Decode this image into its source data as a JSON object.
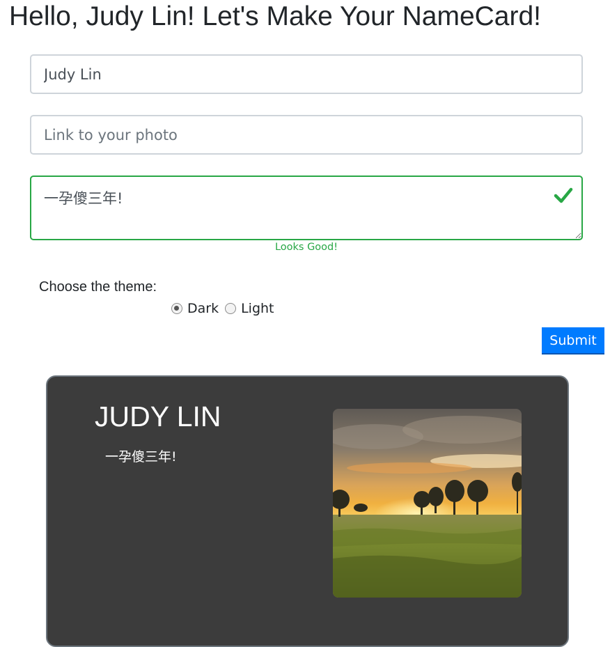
{
  "header": {
    "title": "Hello, Judy Lin! Let's Make Your NameCard!"
  },
  "form": {
    "name_value": "Judy Lin",
    "photo_placeholder": "Link to your photo",
    "photo_value": "",
    "motto_value": "一孕傻三年!",
    "motto_feedback": "Looks Good!",
    "theme_label": "Choose the theme:",
    "theme_options": [
      "Dark",
      "Light"
    ],
    "theme_selected": "Dark",
    "submit_label": "Submit"
  },
  "card": {
    "name": "JUDY LIN",
    "motto": "一孕傻三年!",
    "theme": "Dark",
    "photo_icon": "landscape-sunset-photo"
  },
  "colors": {
    "valid": "#28a745",
    "primary": "#007bff",
    "card_background": "#3c3c3c"
  }
}
